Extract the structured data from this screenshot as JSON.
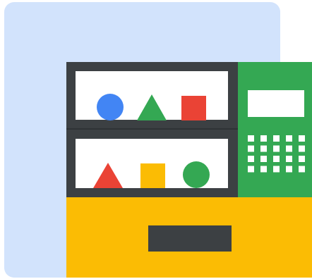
{
  "illustration": {
    "subject": "vending-machine",
    "colors": {
      "page_background": "#ffffff",
      "backdrop_panel": "#d2e3fc",
      "cabinet_frame": "#3c4043",
      "shelf_interior": "#ffffff",
      "control_panel": "#34a853",
      "display": "#ffffff",
      "keypad_key": "#ffffff",
      "base": "#fbbc04",
      "dispense_slot": "#3c4043",
      "shape_blue": "#4285f4",
      "shape_green": "#34a853",
      "shape_red": "#ea4335",
      "shape_yellow": "#fbbc04"
    },
    "shelves": [
      {
        "items": [
          {
            "shape": "circle",
            "color": "#4285f4"
          },
          {
            "shape": "triangle",
            "color": "#34a853"
          },
          {
            "shape": "square",
            "color": "#ea4335"
          }
        ]
      },
      {
        "items": [
          {
            "shape": "triangle",
            "color": "#ea4335"
          },
          {
            "shape": "square",
            "color": "#fbbc04"
          },
          {
            "shape": "circle",
            "color": "#34a853"
          }
        ]
      }
    ],
    "keypad": {
      "rows": 4,
      "columns": 5
    }
  }
}
